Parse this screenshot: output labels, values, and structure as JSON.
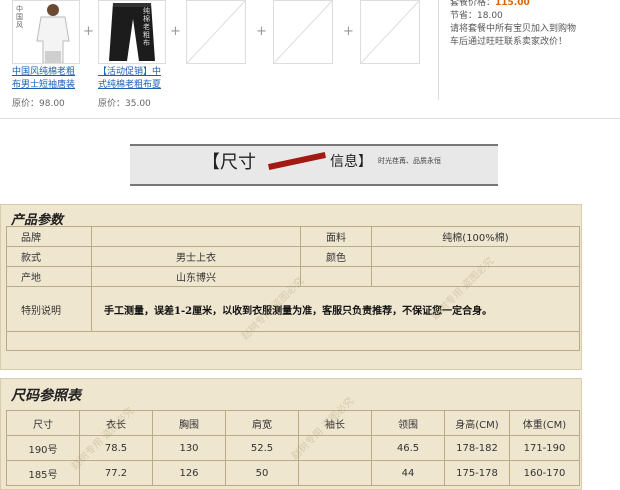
{
  "combo": {
    "products": [
      {
        "name": "中国风纯棉老粗布男士短袖唐装",
        "price_label": "原价：98.00",
        "thumb_mark": "中国风"
      },
      {
        "name": "【活动促销】中式纯棉老粗布夏",
        "price_label": "原价：35.00",
        "thumb_mark": "纯棉老粗布"
      }
    ],
    "plus": "+",
    "package": {
      "price_label": "套餐价格：",
      "price": "115.00",
      "save_label": "节省：",
      "save": "18.00",
      "note": "请将套餐中所有宝贝加入到购物车后通过旺旺联系卖家改价！"
    }
  },
  "header": {
    "title_a": "【尺寸",
    "title_b": "信息】",
    "slogan": "时光荏苒、品质永恒"
  },
  "params": {
    "title": "产品参数",
    "rows": [
      {
        "k1": "品牌",
        "v1": "",
        "k2": "面料",
        "v2": "纯棉(100%棉)"
      },
      {
        "k1": "款式",
        "v1": "男士上衣",
        "k2": "颜色",
        "v2": ""
      },
      {
        "k1": "产地",
        "v1": "山东博兴",
        "k2": "",
        "v2": ""
      }
    ],
    "note_label": "特别说明",
    "note": "手工测量，误差1-2厘米，以收到衣服测量为准，客服只负责推荐，不保证您一定合身。"
  },
  "sizes": {
    "title": "尺码参照表",
    "headers": [
      "尺寸",
      "衣长",
      "胸围",
      "肩宽",
      "袖长",
      "领围",
      "身高",
      "(CM)",
      "体重",
      "(CM)"
    ],
    "rows": [
      [
        "190号",
        "78.5",
        "130",
        "52.5",
        "",
        "46.5",
        "178-182",
        "171-190"
      ],
      [
        "185号",
        "77.2",
        "126",
        "50",
        "",
        "44",
        "175-178",
        "160-170"
      ]
    ]
  },
  "watermark": "赵树专用 盗图必究"
}
